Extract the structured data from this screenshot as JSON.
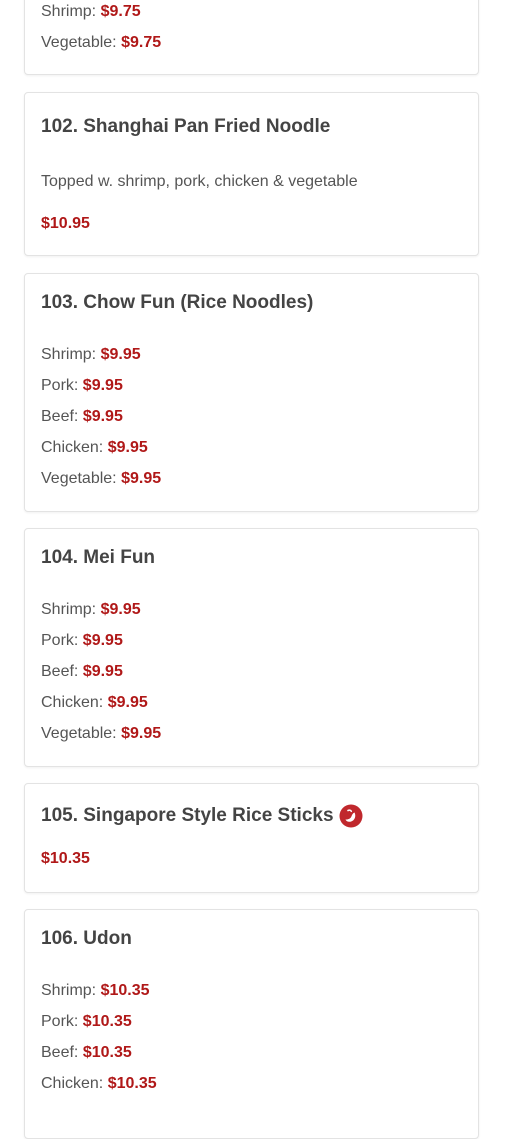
{
  "items": [
    {
      "rows": [
        {
          "label": "Shrimp:",
          "price": "$9.75"
        },
        {
          "label": "Vegetable:",
          "price": "$9.75"
        }
      ]
    },
    {
      "title": "102. Shanghai Pan Fried Noodle",
      "description": "Topped w. shrimp, pork, chicken & vegetable",
      "price": "$10.95"
    },
    {
      "title": "103. Chow Fun (Rice Noodles)",
      "rows": [
        {
          "label": "Shrimp:",
          "price": "$9.95"
        },
        {
          "label": "Pork:",
          "price": "$9.95"
        },
        {
          "label": "Beef:",
          "price": "$9.95"
        },
        {
          "label": "Chicken:",
          "price": "$9.95"
        },
        {
          "label": "Vegetable:",
          "price": "$9.95"
        }
      ]
    },
    {
      "title": "104. Mei Fun",
      "rows": [
        {
          "label": "Shrimp:",
          "price": "$9.95"
        },
        {
          "label": "Pork:",
          "price": "$9.95"
        },
        {
          "label": "Beef:",
          "price": "$9.95"
        },
        {
          "label": "Chicken:",
          "price": "$9.95"
        },
        {
          "label": "Vegetable:",
          "price": "$9.95"
        }
      ]
    },
    {
      "title": "105. Singapore Style Rice Sticks",
      "icon": "spicy-pepper-icon",
      "price": "$10.35"
    },
    {
      "title": "106. Udon",
      "rows": [
        {
          "label": "Shrimp:",
          "price": "$10.35"
        },
        {
          "label": "Pork:",
          "price": "$10.35"
        },
        {
          "label": "Beef:",
          "price": "$10.35"
        },
        {
          "label": "Chicken:",
          "price": "$10.35"
        }
      ]
    }
  ],
  "colors": {
    "price": "#b01818",
    "icon": "#c0282d",
    "text": "#555555"
  }
}
